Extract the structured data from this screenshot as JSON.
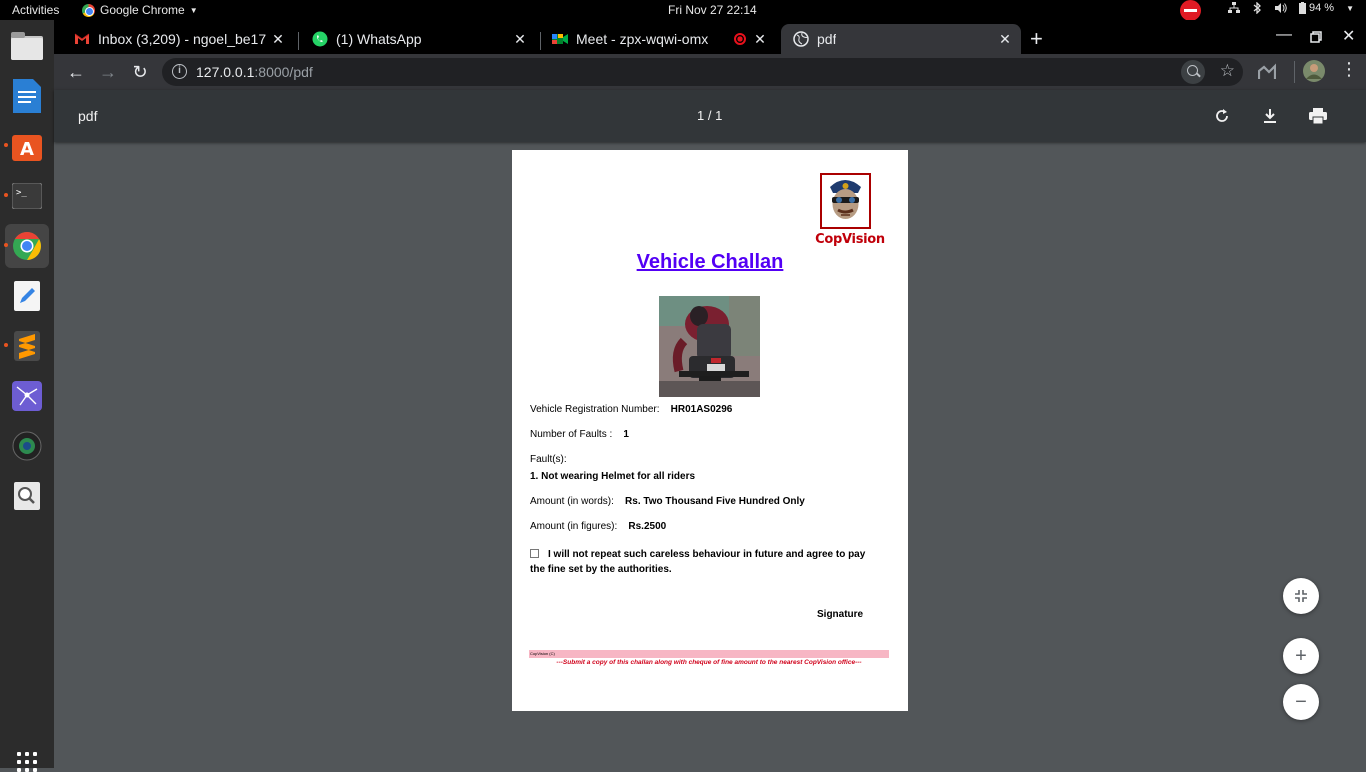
{
  "topbar": {
    "activities": "Activities",
    "app_name": "Google Chrome",
    "clock": "Fri Nov 27  22:14",
    "battery": "94 %"
  },
  "tabs": [
    {
      "title": "Inbox (3,209) - ngoel_be17",
      "icon": "gmail-icon",
      "active": false
    },
    {
      "title": "(1) WhatsApp",
      "icon": "whatsapp-icon",
      "active": false
    },
    {
      "title": "Meet - zpx-wqwi-omx",
      "icon": "meet-icon",
      "active": false
    },
    {
      "title": "pdf",
      "icon": "globe-icon",
      "active": true
    }
  ],
  "omnibox": {
    "host": "127.0.0.1",
    "rest": ":8000/pdf"
  },
  "pdf_viewer": {
    "title": "pdf",
    "page_indicator": "1 / 1"
  },
  "document": {
    "logo_text": "CopVision",
    "heading": "Vehicle Challan",
    "reg_label": "Vehicle Registration Number:",
    "reg_value": "HR01AS0296",
    "faults_count_label": "Number of Faults :",
    "faults_count_value": "1",
    "faults_label": "Fault(s):",
    "fault_1": "1. Not wearing Helmet for all riders",
    "amount_words_label": "Amount (in words):",
    "amount_words_value": "Rs. Two Thousand Five Hundred Only",
    "amount_figures_label": "Amount (in figures):",
    "amount_figures_value": "Rs.2500",
    "consent_text": "I will not repeat such careless behaviour in future and agree to pay the fine set by the authorities.",
    "signature_label": "Signature",
    "footer_copyright": "CopVision (C)",
    "footer_note": "---Submit a copy of this challan along with cheque of fine amount to the nearest CopVision office---"
  },
  "colors": {
    "heading": "#5300f5",
    "footer_band": "#f7b6c4",
    "footer_note": "#d0021b",
    "logo": "#c0000a"
  }
}
